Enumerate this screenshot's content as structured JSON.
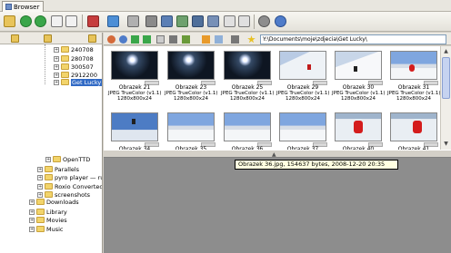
{
  "tab": {
    "label": "Browser"
  },
  "address": {
    "path": "Y:\\Documents\\moje\\zdjecia\\Get Lucky\\"
  },
  "tree": {
    "items": [
      {
        "label": "240708"
      },
      {
        "label": "280708"
      },
      {
        "label": "300507"
      },
      {
        "label": "2912200"
      },
      {
        "label": "Get Lucky"
      },
      {
        "label": "OpenTTD"
      },
      {
        "label": "Parallels"
      },
      {
        "label": "pyro player — ru"
      },
      {
        "label": "Roxio Converted"
      },
      {
        "label": "screenshots"
      },
      {
        "label": "Downloads"
      },
      {
        "label": "Library"
      },
      {
        "label": "Movies"
      },
      {
        "label": "Music"
      }
    ]
  },
  "thumbnails": [
    {
      "name": "Obrazek 21",
      "format": "JPEG TrueColor (v1.1)",
      "size": "1280x800x24"
    },
    {
      "name": "Obrazek 23",
      "format": "JPEG TrueColor (v1.1)",
      "size": "1280x800x24"
    },
    {
      "name": "Obrazek 25",
      "format": "JPEG TrueColor (v1.1)",
      "size": "1280x800x24"
    },
    {
      "name": "Obrazek 29",
      "format": "JPEG TrueColor (v1.1)",
      "size": "1280x800x24"
    },
    {
      "name": "Obrazek 30",
      "format": "JPEG TrueColor (v1.1)",
      "size": "1280x800x24"
    },
    {
      "name": "Obrazek 31",
      "format": "JPEG TrueColor (v1.1)",
      "size": "1280x800x24"
    },
    {
      "name": "Obrazek 34",
      "format": "",
      "size": ""
    },
    {
      "name": "Obrazek 35",
      "format": "",
      "size": ""
    },
    {
      "name": "Obrazek 36",
      "format": "",
      "size": ""
    },
    {
      "name": "Obrazek 37",
      "format": "",
      "size": ""
    },
    {
      "name": "Obrazek 40",
      "format": "",
      "size": ""
    },
    {
      "name": "Obrazek 41",
      "format": "",
      "size": ""
    }
  ],
  "tooltip": {
    "text": "Obrazek 36.jpg, 154637 bytes, 2008-12-20 20:35"
  },
  "colors": {
    "selection": "#316ac5",
    "preview_bg": "#8d8d8d",
    "tooltip_bg": "#ffffe1"
  }
}
